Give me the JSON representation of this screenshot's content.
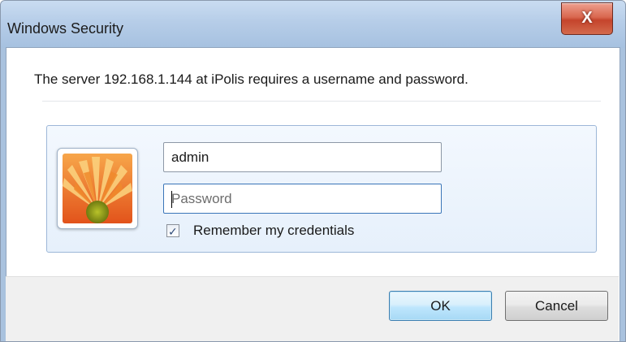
{
  "window": {
    "title": "Windows Security",
    "close_label": "X"
  },
  "prompt": {
    "message": "The server 192.168.1.144 at iPolis requires a username and password."
  },
  "credentials": {
    "avatar_icon": "user-flower-picture-icon",
    "username_value": "admin",
    "password_placeholder": "Password",
    "remember_label": "Remember my credentials",
    "remember_checked": true
  },
  "buttons": {
    "ok_label": "OK",
    "cancel_label": "Cancel"
  },
  "colors": {
    "title_bar": "#b6cde8",
    "close_button": "#c5442c",
    "credential_panel": "#e6f0fb",
    "default_button": "#bee6fd"
  }
}
